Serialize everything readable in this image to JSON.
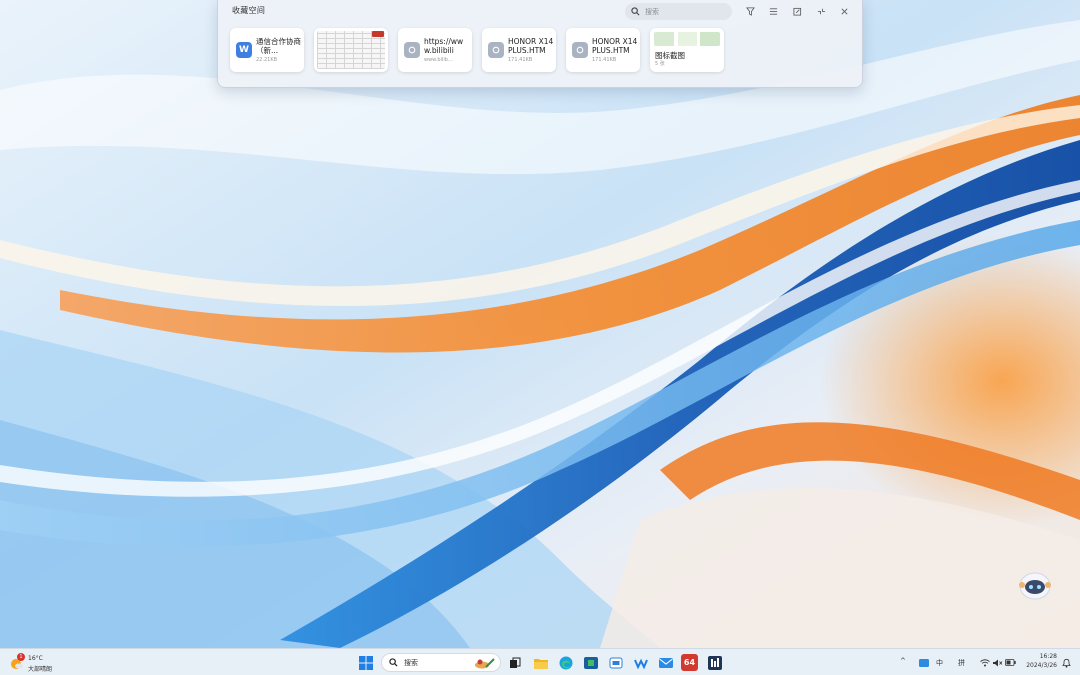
{
  "panel": {
    "title": "收藏空间",
    "search_placeholder": "搜索",
    "controls": [
      "filter-icon",
      "list-icon",
      "popout-icon",
      "collapse-icon",
      "close-icon"
    ],
    "cards": [
      {
        "type": "file",
        "icon": "word-doc-icon",
        "icon_letter": "W",
        "icon_color": "#3f7fe0",
        "title": "通信合作协商（新",
        "ellipsis": "...",
        "sub": "22.21KB"
      },
      {
        "type": "image",
        "sub": ""
      },
      {
        "type": "link",
        "icon": "link-icon",
        "title": "https://www.bilibili",
        "sub": "www.bilib..."
      },
      {
        "type": "file",
        "icon": "html-file-icon",
        "title": "HONOR X14 PLUS.HTM",
        "sub": "171.41KB"
      },
      {
        "type": "file",
        "icon": "html-file-icon",
        "title": "HONOR X14 PLUS.HTM",
        "sub": "171.41KB"
      },
      {
        "type": "image-group",
        "title": "图标截图",
        "sub": "5 张"
      }
    ]
  },
  "taskbar": {
    "weather": {
      "badge": "1",
      "temp": "16°C",
      "desc": "大部晴朗"
    },
    "search_placeholder": "搜索",
    "apps": [
      "start-icon",
      "task-view-icon",
      "file-explorer-icon",
      "edge-icon",
      "store-icon",
      "messages-icon",
      "wechat-work-icon",
      "mail-icon",
      "app-64-icon",
      "calculator-icon"
    ],
    "app64_label": "64",
    "tray": {
      "chevron": "^",
      "lang": "中",
      "ime": "拼"
    },
    "clock": {
      "time": "16:28",
      "date": "2024/3/26"
    }
  },
  "colors": {
    "accent_blue": "#1f6fd6",
    "accent_orange": "#f08a2a",
    "panel_bg": "#eef2f7"
  }
}
